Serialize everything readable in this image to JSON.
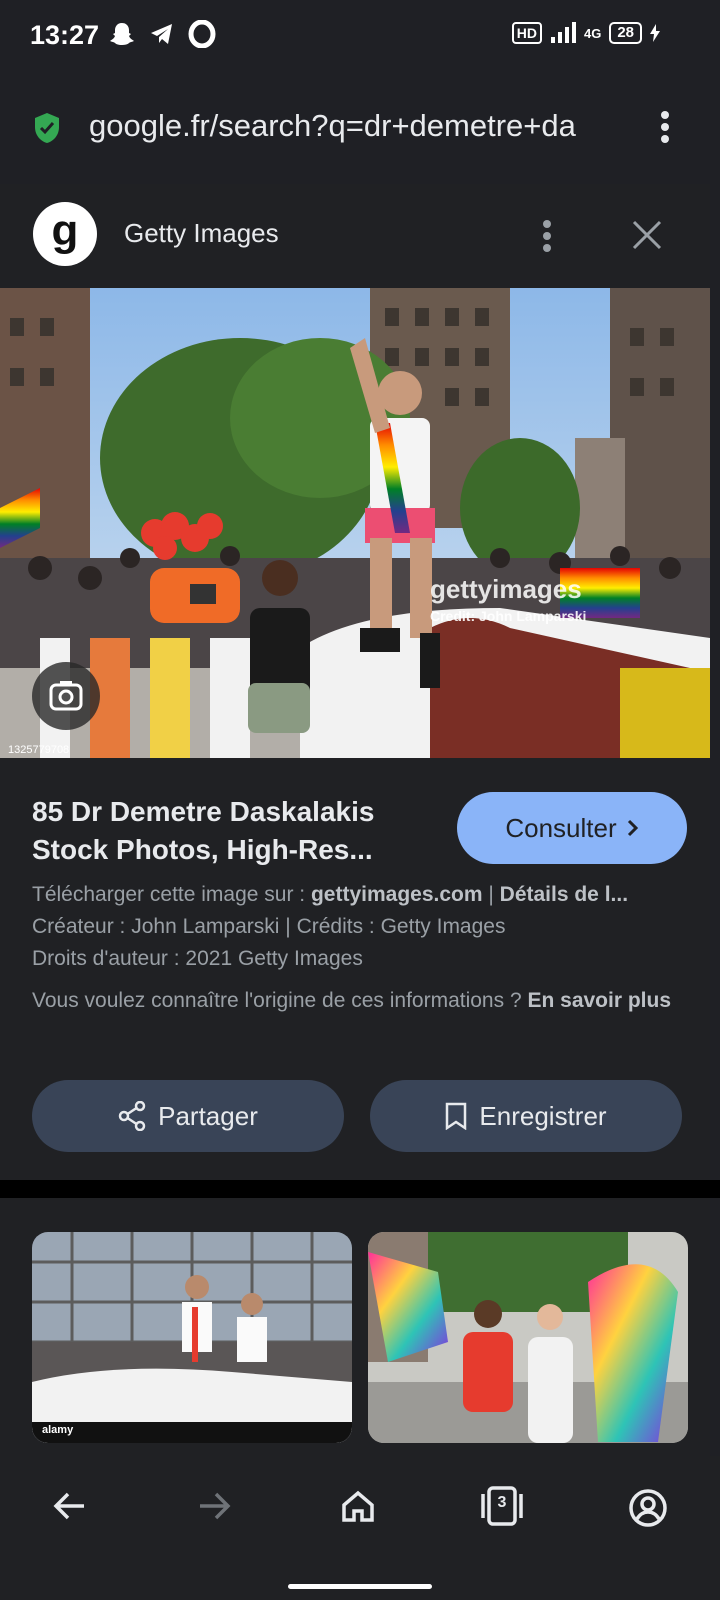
{
  "status_bar": {
    "time": "13:27",
    "hd": "HD",
    "network": "4G",
    "battery": "28"
  },
  "url_bar": {
    "url": "google.fr/search?q=dr+demetre+da"
  },
  "result": {
    "source": "Getty Images",
    "logo_letter": "g",
    "image_id": "1325779708",
    "watermark": "gettyimages",
    "credit_overlay": "Credit: John Lamparski",
    "title": "85 Dr Demetre Daskalakis Stock Photos, High-Res...",
    "consult_label": "Consulter",
    "download_prefix": "Télécharger cette image sur : ",
    "download_site": "gettyimages.com",
    "download_sep": " | ",
    "download_details": "Détails de l...",
    "creator_line": "Créateur : John Lamparski | Crédits : Getty Images",
    "copyright_line": "Droits d'auteur : 2021 Getty Images",
    "origin_question": "Vous voulez connaître l'origine de ces informations ? ",
    "learn_more": "En savoir plus",
    "share_label": "Partager",
    "save_label": "Enregistrer"
  },
  "related": {
    "thumb1_brand": "alamy",
    "thumb2_brand": ""
  },
  "nav": {
    "tab_count": "3"
  },
  "colors": {
    "accent": "#8ab4f8",
    "background": "#202124",
    "pill": "#394457",
    "shield": "#34a853"
  }
}
